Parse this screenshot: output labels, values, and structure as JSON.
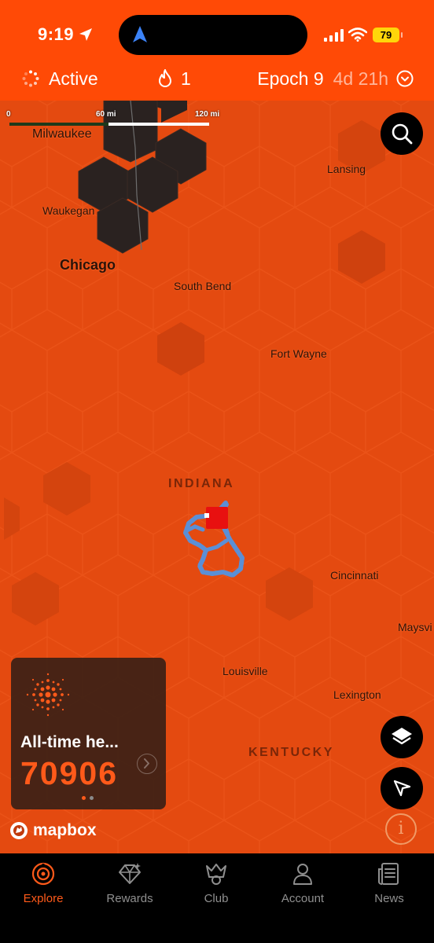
{
  "status_bar": {
    "time": "9:19",
    "battery": "79",
    "icons": [
      "location-arrow-icon",
      "navigation-icon",
      "cellular-signal-icon",
      "wifi-icon",
      "battery-icon"
    ]
  },
  "header": {
    "status_label": "Active",
    "flame_count": "1",
    "epoch_label": "Epoch 9",
    "epoch_remaining": "4d 21h",
    "icons": [
      "active-spinner-icon",
      "flame-icon",
      "chevron-down-circle-icon"
    ]
  },
  "map": {
    "scale": {
      "labels": [
        "0",
        "60 mi",
        "120 mi"
      ]
    },
    "cities": [
      {
        "name": "Milwaukee",
        "size": "normal"
      },
      {
        "name": "Lansing",
        "size": "normal"
      },
      {
        "name": "Waukegan",
        "size": "normal"
      },
      {
        "name": "Chicago",
        "size": "big"
      },
      {
        "name": "South Bend",
        "size": "normal"
      },
      {
        "name": "Fort Wayne",
        "size": "normal"
      },
      {
        "name": "Cincinnati",
        "size": "normal"
      },
      {
        "name": "Maysvi",
        "size": "normal"
      },
      {
        "name": "Louisville",
        "size": "normal"
      },
      {
        "name": "Lexington",
        "size": "normal"
      }
    ],
    "states": [
      "INDIANA",
      "KENTUCKY"
    ],
    "colors": {
      "base": "#e44a10",
      "dark_hex": "#2a2220",
      "track": "#5b8fd6",
      "marker": "#e81010"
    },
    "buttons": [
      "search-icon",
      "layers-icon",
      "navigation-arrow-icon",
      "info-icon"
    ]
  },
  "heat_card": {
    "label": "All-time he...",
    "value": "70906",
    "page_count": 2,
    "current_page": 1,
    "accent": "#ff5a1a"
  },
  "attribution": {
    "text": "mapbox"
  },
  "tabs": [
    {
      "label": "Explore",
      "icon": "explore-icon",
      "active": true
    },
    {
      "label": "Rewards",
      "icon": "rewards-icon",
      "active": false
    },
    {
      "label": "Club",
      "icon": "club-icon",
      "active": false
    },
    {
      "label": "Account",
      "icon": "account-icon",
      "active": false
    },
    {
      "label": "News",
      "icon": "news-icon",
      "active": false
    }
  ]
}
